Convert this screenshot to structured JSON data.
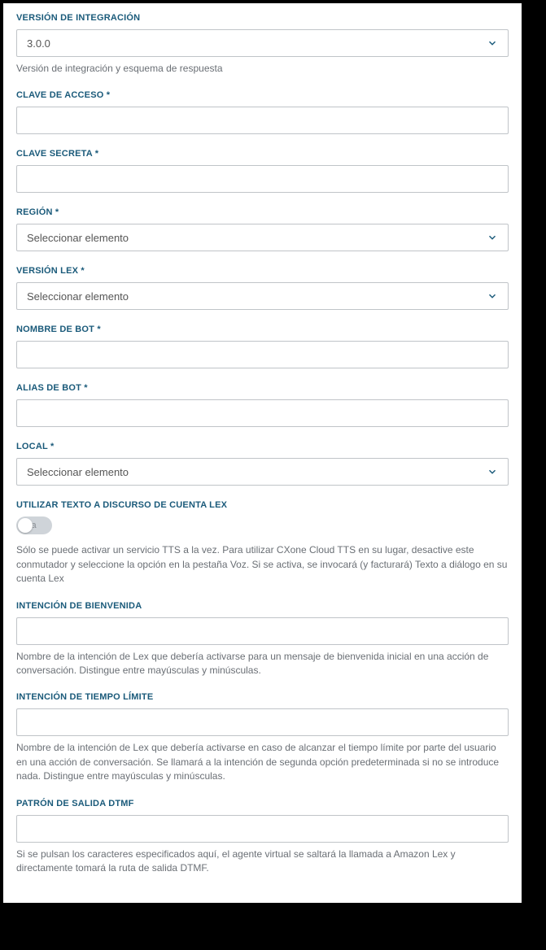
{
  "fields": {
    "integration_version": {
      "label": "VERSIÓN DE INTEGRACIÓN",
      "selected": "3.0.0",
      "help": "Versión de integración y esquema de respuesta"
    },
    "access_key": {
      "label": "CLAVE DE ACCESO *",
      "value": ""
    },
    "secret_key": {
      "label": "CLAVE SECRETA *",
      "value": ""
    },
    "region": {
      "label": "REGIÓN *",
      "placeholder": "Seleccionar elemento"
    },
    "lex_version": {
      "label": "VERSIÓN LEX *",
      "placeholder": "Seleccionar elemento"
    },
    "bot_name": {
      "label": "NOMBRE DE BOT *",
      "value": ""
    },
    "bot_alias": {
      "label": "ALIAS DE BOT *",
      "value": ""
    },
    "locale": {
      "label": "LOCAL *",
      "placeholder": "Seleccionar elemento"
    },
    "lex_tts": {
      "label": "UTILIZAR TEXTO A DISCURSO DE CUENTA LEX",
      "toggle_text": "ula",
      "enabled": false,
      "help": "Sólo se puede activar un servicio TTS a la vez. Para utilizar CXone Cloud TTS en su lugar, desactive este conmutador y seleccione la opción en la pestaña Voz. Si se activa, se invocará (y facturará) Texto a diálogo en su cuenta Lex"
    },
    "welcome_intent": {
      "label": "INTENCIÓN DE BIENVENIDA",
      "value": "",
      "help": "Nombre de la intención de Lex que debería activarse para un mensaje de bienvenida inicial en una acción de conversación. Distingue entre mayúsculas y minúsculas."
    },
    "timeout_intent": {
      "label": "INTENCIÓN DE TIEMPO LÍMITE",
      "value": "",
      "help": "Nombre de la intención de Lex que debería activarse en caso de alcanzar el tiempo límite por parte del usuario en una acción de conversación. Se llamará a la intención de segunda opción predeterminada si no se introduce nada. Distingue entre mayúsculas y minúsculas."
    },
    "dtmf_pattern": {
      "label": "PATRÓN DE SALIDA DTMF",
      "value": "",
      "help": "Si se pulsan los caracteres especificados aquí, el agente virtual se saltará la llamada a Amazon Lex y directamente tomará la ruta de salida DTMF."
    }
  }
}
